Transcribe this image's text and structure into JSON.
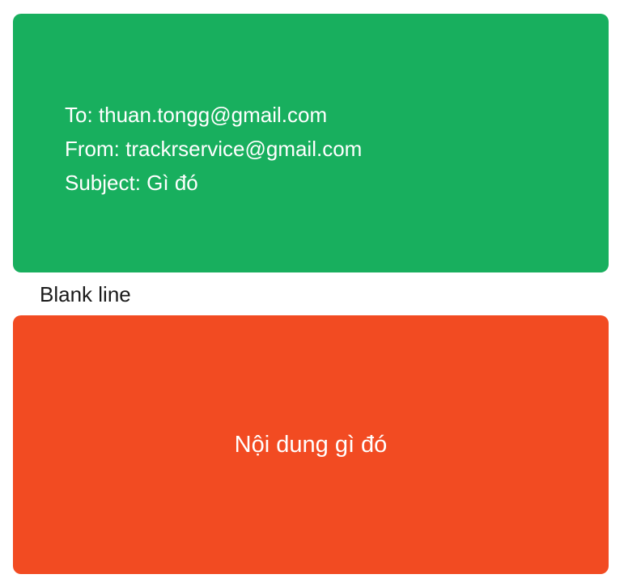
{
  "header": {
    "color": "#18AF5E",
    "lines": [
      "To: thuan.tongg@gmail.com",
      "From: trackrservice@gmail.com",
      "Subject: Gì đó"
    ]
  },
  "separator": {
    "label": "Blank line"
  },
  "body": {
    "color": "#F24B22",
    "text": "Nội dung gì đó"
  }
}
